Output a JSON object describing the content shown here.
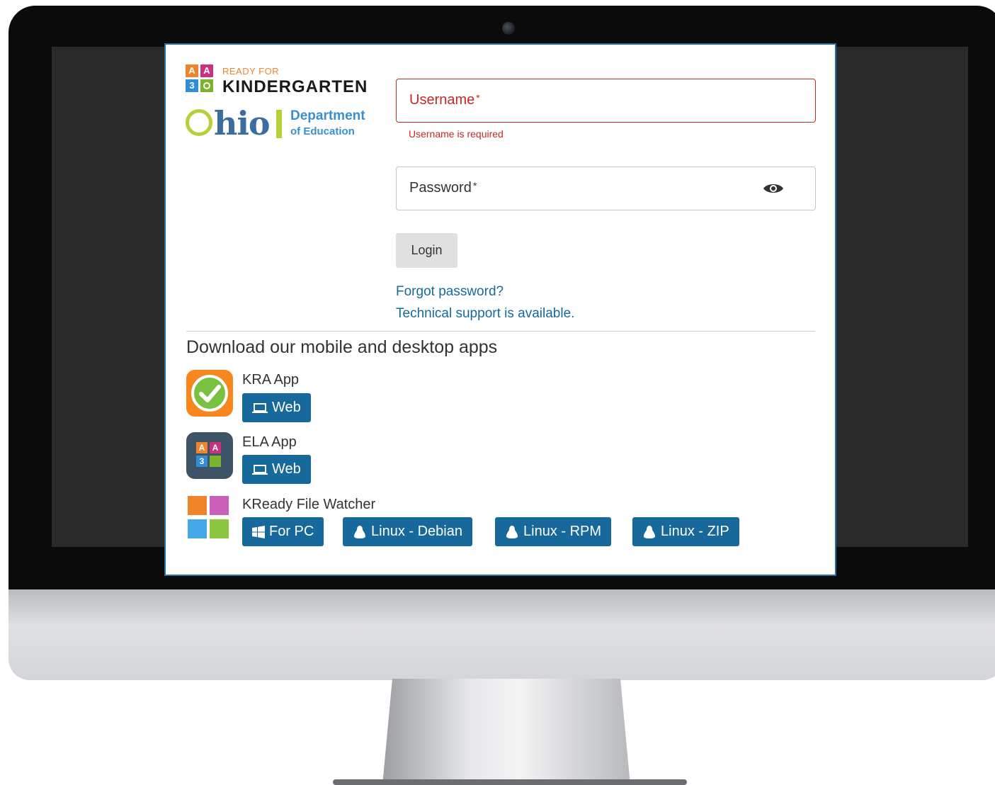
{
  "logo": {
    "ready_for": "READY FOR",
    "kindergarten": "KINDERGARTEN",
    "ohio": "hio",
    "department": "Department",
    "of_education": "of Education",
    "blocks": [
      "A",
      "A",
      "3",
      ""
    ]
  },
  "form": {
    "username_label": "Username",
    "username_required": "*",
    "username_error": "Username is required",
    "password_label": "Password",
    "password_required": "*",
    "login_label": "Login",
    "forgot_link": "Forgot password?",
    "support_link": "Technical support is available."
  },
  "downloads": {
    "title": "Download our mobile and desktop apps",
    "apps": [
      {
        "name": "KRA App",
        "buttons": [
          {
            "label": "Web",
            "icon": "laptop-icon"
          }
        ]
      },
      {
        "name": "ELA App",
        "buttons": [
          {
            "label": "Web",
            "icon": "laptop-icon"
          }
        ]
      },
      {
        "name": "KReady File Watcher",
        "buttons": [
          {
            "label": "For PC",
            "icon": "windows-icon"
          },
          {
            "label": "Linux - Debian",
            "icon": "linux-icon"
          },
          {
            "label": "Linux - RPM",
            "icon": "linux-icon"
          },
          {
            "label": "Linux - ZIP",
            "icon": "linux-icon"
          }
        ]
      }
    ]
  },
  "colors": {
    "primary": "#17699b",
    "error": "#c62828",
    "kra_orange": "#f7861e",
    "ela_slate": "#3f5366"
  }
}
